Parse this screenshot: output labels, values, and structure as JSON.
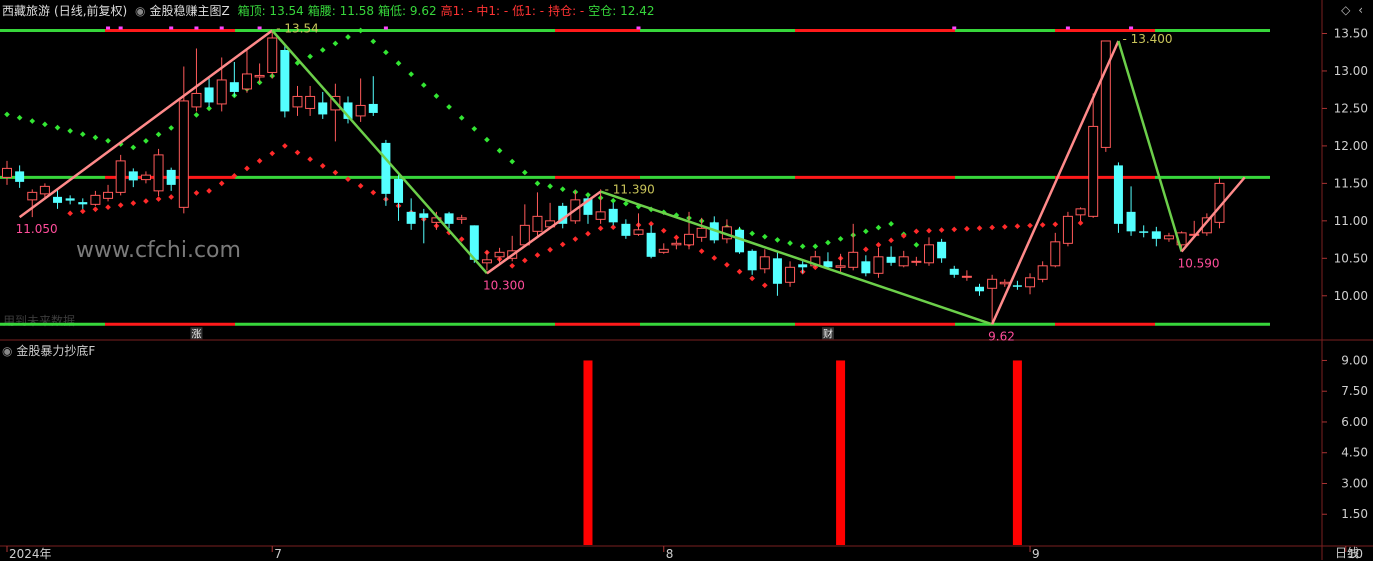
{
  "main_header": {
    "stock": "西藏旅游",
    "period_adj": "(日线,前复权)",
    "indicator": "金股稳赚主图Z",
    "items": [
      {
        "label": "箱顶:",
        "value": "13.54",
        "color": "#37d63b"
      },
      {
        "label": "箱腰:",
        "value": "11.58",
        "color": "#37d63b"
      },
      {
        "label": "箱低:",
        "value": "9.62",
        "color": "#37d63b"
      },
      {
        "label": "高1:",
        "value": "-",
        "color": "#ff3333"
      },
      {
        "label": "中1:",
        "value": "-",
        "color": "#ff3333"
      },
      {
        "label": "低1:",
        "value": "-",
        "color": "#ff3333"
      },
      {
        "label": "持仓:",
        "value": "-",
        "color": "#ff3333"
      },
      {
        "label": "空仓:",
        "value": "12.42",
        "color": "#37d63b"
      }
    ]
  },
  "sub_header": {
    "indicator": "金股暴力抄底F"
  },
  "corner_icons": [
    "diamond-icon",
    "chevron-icon"
  ],
  "period_label": "日线",
  "watermark": "www.cfchi.com",
  "faded_text": "用到未来数据",
  "band_markers": [
    {
      "text": "涨",
      "candle": 15
    },
    {
      "text": "财",
      "candle": 65
    }
  ],
  "chart_data": [
    {
      "type": "candlestick",
      "ylim": [
        9.45,
        13.68
      ],
      "yticks": [
        "13.50",
        "13.00",
        "12.50",
        "12.00",
        "11.50",
        "11.00",
        "10.50",
        "10.00"
      ],
      "x_labels": [
        {
          "text": "2024年",
          "candle": 0
        },
        {
          "text": "7",
          "candle": 21
        },
        {
          "text": "8",
          "candle": 52
        },
        {
          "text": "9",
          "candle": 81
        },
        {
          "text": "10",
          "candle": 106
        }
      ],
      "box_levels": {
        "top": 13.54,
        "mid": 11.58,
        "low": 9.62
      },
      "candles": [
        [
          11.58,
          11.7,
          11.8,
          11.48
        ],
        [
          11.66,
          11.52,
          11.74,
          11.44
        ],
        [
          11.28,
          11.38,
          11.42,
          11.05
        ],
        [
          11.36,
          11.46,
          11.5,
          11.3
        ],
        [
          11.32,
          11.24,
          11.43,
          11.16
        ],
        [
          11.3,
          11.27,
          11.34,
          11.22
        ],
        [
          11.25,
          11.22,
          11.3,
          11.16
        ],
        [
          11.22,
          11.34,
          11.4,
          11.2
        ],
        [
          11.3,
          11.38,
          11.48,
          11.26
        ],
        [
          11.38,
          11.8,
          11.88,
          11.34
        ],
        [
          11.66,
          11.54,
          11.7,
          11.45
        ],
        [
          11.55,
          11.61,
          11.66,
          11.5
        ],
        [
          11.4,
          11.88,
          11.96,
          11.33
        ],
        [
          11.68,
          11.48,
          11.71,
          11.4
        ],
        [
          11.18,
          12.6,
          13.06,
          11.1
        ],
        [
          12.52,
          12.7,
          13.3,
          12.46
        ],
        [
          12.78,
          12.58,
          12.92,
          12.52
        ],
        [
          12.56,
          12.88,
          13.18,
          12.46
        ],
        [
          12.85,
          12.72,
          13.12,
          12.66
        ],
        [
          12.76,
          12.96,
          13.3,
          12.71
        ],
        [
          12.92,
          12.94,
          13.1,
          12.84
        ],
        [
          12.98,
          13.44,
          13.54,
          12.9
        ],
        [
          13.28,
          12.46,
          13.34,
          12.38
        ],
        [
          12.52,
          12.66,
          12.8,
          12.4
        ],
        [
          12.5,
          12.66,
          12.8,
          12.4
        ],
        [
          12.58,
          12.42,
          12.72,
          12.36
        ],
        [
          12.48,
          12.66,
          12.83,
          12.06
        ],
        [
          12.58,
          12.36,
          12.66,
          12.3
        ],
        [
          12.4,
          12.54,
          12.9,
          12.32
        ],
        [
          12.56,
          12.44,
          12.93,
          12.4
        ],
        [
          12.04,
          11.36,
          12.08,
          11.2
        ],
        [
          11.56,
          11.24,
          11.62,
          11.0
        ],
        [
          11.12,
          10.96,
          11.3,
          10.88
        ],
        [
          11.1,
          11.04,
          11.16,
          10.7
        ],
        [
          10.98,
          11.04,
          11.12,
          10.88
        ],
        [
          11.1,
          10.96,
          11.12,
          10.9
        ],
        [
          11.02,
          11.04,
          11.08,
          10.96
        ],
        [
          10.94,
          10.48,
          10.94,
          10.44
        ],
        [
          10.44,
          10.48,
          10.6,
          10.34
        ],
        [
          10.52,
          10.58,
          10.64,
          10.44
        ],
        [
          10.5,
          10.6,
          10.8,
          10.46
        ],
        [
          10.68,
          10.94,
          11.22,
          10.68
        ],
        [
          10.86,
          11.06,
          11.38,
          10.8
        ],
        [
          10.92,
          11.0,
          11.24,
          10.9
        ],
        [
          11.2,
          10.96,
          11.24,
          10.9
        ],
        [
          11.0,
          11.28,
          11.4,
          10.96
        ],
        [
          11.3,
          11.08,
          11.32,
          10.96
        ],
        [
          11.02,
          11.12,
          11.42,
          10.96
        ],
        [
          11.16,
          10.98,
          11.24,
          10.94
        ],
        [
          10.96,
          10.8,
          11.02,
          10.76
        ],
        [
          10.82,
          10.88,
          11.1,
          10.8
        ],
        [
          10.84,
          10.52,
          10.94,
          10.5
        ],
        [
          10.58,
          10.62,
          10.7,
          10.56
        ],
        [
          10.68,
          10.7,
          10.74,
          10.62
        ],
        [
          10.68,
          10.82,
          11.12,
          10.62
        ],
        [
          10.78,
          10.9,
          11.04,
          10.72
        ],
        [
          10.98,
          10.74,
          11.06,
          10.7
        ],
        [
          10.76,
          10.92,
          11.02,
          10.7
        ],
        [
          10.88,
          10.58,
          10.92,
          10.56
        ],
        [
          10.6,
          10.34,
          10.62,
          10.28
        ],
        [
          10.36,
          10.52,
          10.62,
          10.3
        ],
        [
          10.5,
          10.16,
          10.6,
          10.0
        ],
        [
          10.18,
          10.38,
          10.46,
          10.12
        ],
        [
          10.42,
          10.38,
          10.48,
          10.3
        ],
        [
          10.4,
          10.52,
          10.6,
          10.38
        ],
        [
          10.46,
          10.38,
          10.58,
          10.36
        ],
        [
          10.38,
          10.4,
          10.56,
          10.3
        ],
        [
          10.38,
          10.58,
          10.96,
          10.34
        ],
        [
          10.46,
          10.3,
          10.54,
          10.26
        ],
        [
          10.3,
          10.52,
          10.64,
          10.24
        ],
        [
          10.52,
          10.44,
          10.66,
          10.4
        ],
        [
          10.4,
          10.52,
          10.6,
          10.38
        ],
        [
          10.46,
          10.46,
          10.52,
          10.4
        ],
        [
          10.44,
          10.68,
          10.78,
          10.4
        ],
        [
          10.72,
          10.5,
          10.76,
          10.44
        ],
        [
          10.36,
          10.28,
          10.4,
          10.24
        ],
        [
          10.26,
          10.26,
          10.34,
          10.2
        ],
        [
          10.12,
          10.06,
          10.16,
          10.0
        ],
        [
          10.1,
          10.22,
          10.28,
          9.62
        ],
        [
          10.16,
          10.18,
          10.22,
          10.12
        ],
        [
          10.14,
          10.12,
          10.2,
          10.08
        ],
        [
          10.12,
          10.24,
          10.3,
          10.02
        ],
        [
          10.22,
          10.4,
          10.46,
          10.18
        ],
        [
          10.4,
          10.72,
          10.84,
          10.38
        ],
        [
          10.7,
          11.06,
          11.12,
          10.66
        ],
        [
          11.08,
          11.16,
          11.18,
          11.0
        ],
        [
          11.06,
          12.26,
          12.7,
          11.04
        ],
        [
          11.98,
          13.4,
          13.4,
          11.92
        ],
        [
          11.74,
          10.96,
          11.78,
          10.84
        ],
        [
          11.12,
          10.86,
          11.46,
          10.8
        ],
        [
          10.86,
          10.84,
          10.94,
          10.78
        ],
        [
          10.86,
          10.76,
          10.92,
          10.66
        ],
        [
          10.76,
          10.8,
          10.84,
          10.72
        ],
        [
          10.68,
          10.84,
          10.86,
          10.6
        ],
        [
          10.82,
          10.82,
          11.0,
          10.78
        ],
        [
          10.84,
          11.04,
          11.1,
          10.8
        ],
        [
          10.98,
          11.5,
          11.58,
          10.9
        ]
      ],
      "zigzag": [
        {
          "candle": 1,
          "price": 11.05,
          "label": "11.050"
        },
        {
          "candle": 21,
          "price": 13.54,
          "label": "13.54"
        },
        {
          "candle": 38,
          "price": 10.3,
          "label": "10.300"
        },
        {
          "candle": 47,
          "price": 11.39,
          "label": "11.390"
        },
        {
          "candle": 78,
          "price": 9.62,
          "label": "9.62"
        },
        {
          "candle": 88,
          "price": 13.4,
          "label": "13.400"
        },
        {
          "candle": 93,
          "price": 10.59,
          "label": "10.590"
        },
        {
          "candle": 98,
          "price": 11.58,
          "label": ""
        }
      ],
      "up_dots": [
        {
          "candle": 0,
          "price": 12.42
        },
        {
          "candle": 10,
          "price": 11.98
        },
        {
          "candle": 28,
          "price": 13.54
        },
        {
          "candle": 42,
          "price": 11.5
        },
        {
          "candle": 56,
          "price": 10.96
        },
        {
          "candle": 63,
          "price": 10.66
        },
        {
          "candle": 64,
          "price": 10.66
        },
        {
          "candle": 70,
          "price": 10.96
        },
        {
          "candle": 74,
          "price": 10.4
        }
      ],
      "down_dots": [
        {
          "candle": 5,
          "price": 11.1
        },
        {
          "candle": 16,
          "price": 11.4
        },
        {
          "candle": 22,
          "price": 12.0
        },
        {
          "candle": 40,
          "price": 10.4
        },
        {
          "candle": 47,
          "price": 10.9
        },
        {
          "candle": 51,
          "price": 10.96
        },
        {
          "candle": 60,
          "price": 10.14
        },
        {
          "candle": 72,
          "price": 10.86
        },
        {
          "candle": 86,
          "price": 10.98
        }
      ]
    },
    {
      "type": "bar",
      "ylim": [
        0,
        9.9
      ],
      "yticks": [
        "9.00",
        "7.50",
        "6.00",
        "4.50",
        "3.00",
        "1.50"
      ],
      "bars": [
        {
          "candle": 46,
          "value": 9.0
        },
        {
          "candle": 66,
          "value": 9.0
        },
        {
          "candle": 80,
          "value": 9.0
        }
      ]
    }
  ]
}
